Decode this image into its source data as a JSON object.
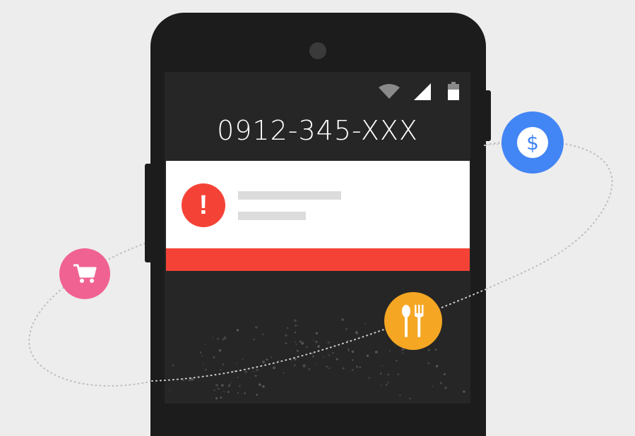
{
  "phone": {
    "number": "0912-345-XXX",
    "status_icons": [
      "wifi-icon",
      "signal-icon",
      "battery-icon"
    ]
  },
  "alert": {
    "icon_glyph": "!",
    "accent_color": "#f44336"
  },
  "badges": [
    {
      "name": "dollar-badge",
      "icon": "dollar-icon",
      "color": "#4285f4"
    },
    {
      "name": "cart-badge",
      "icon": "shopping-cart-icon",
      "color": "#f06292"
    },
    {
      "name": "dining-badge",
      "icon": "fork-spoon-icon",
      "color": "#f5a623"
    }
  ],
  "colors": {
    "background": "#ededed",
    "phone_body": "#1c1c1c",
    "screen": "#262626"
  }
}
